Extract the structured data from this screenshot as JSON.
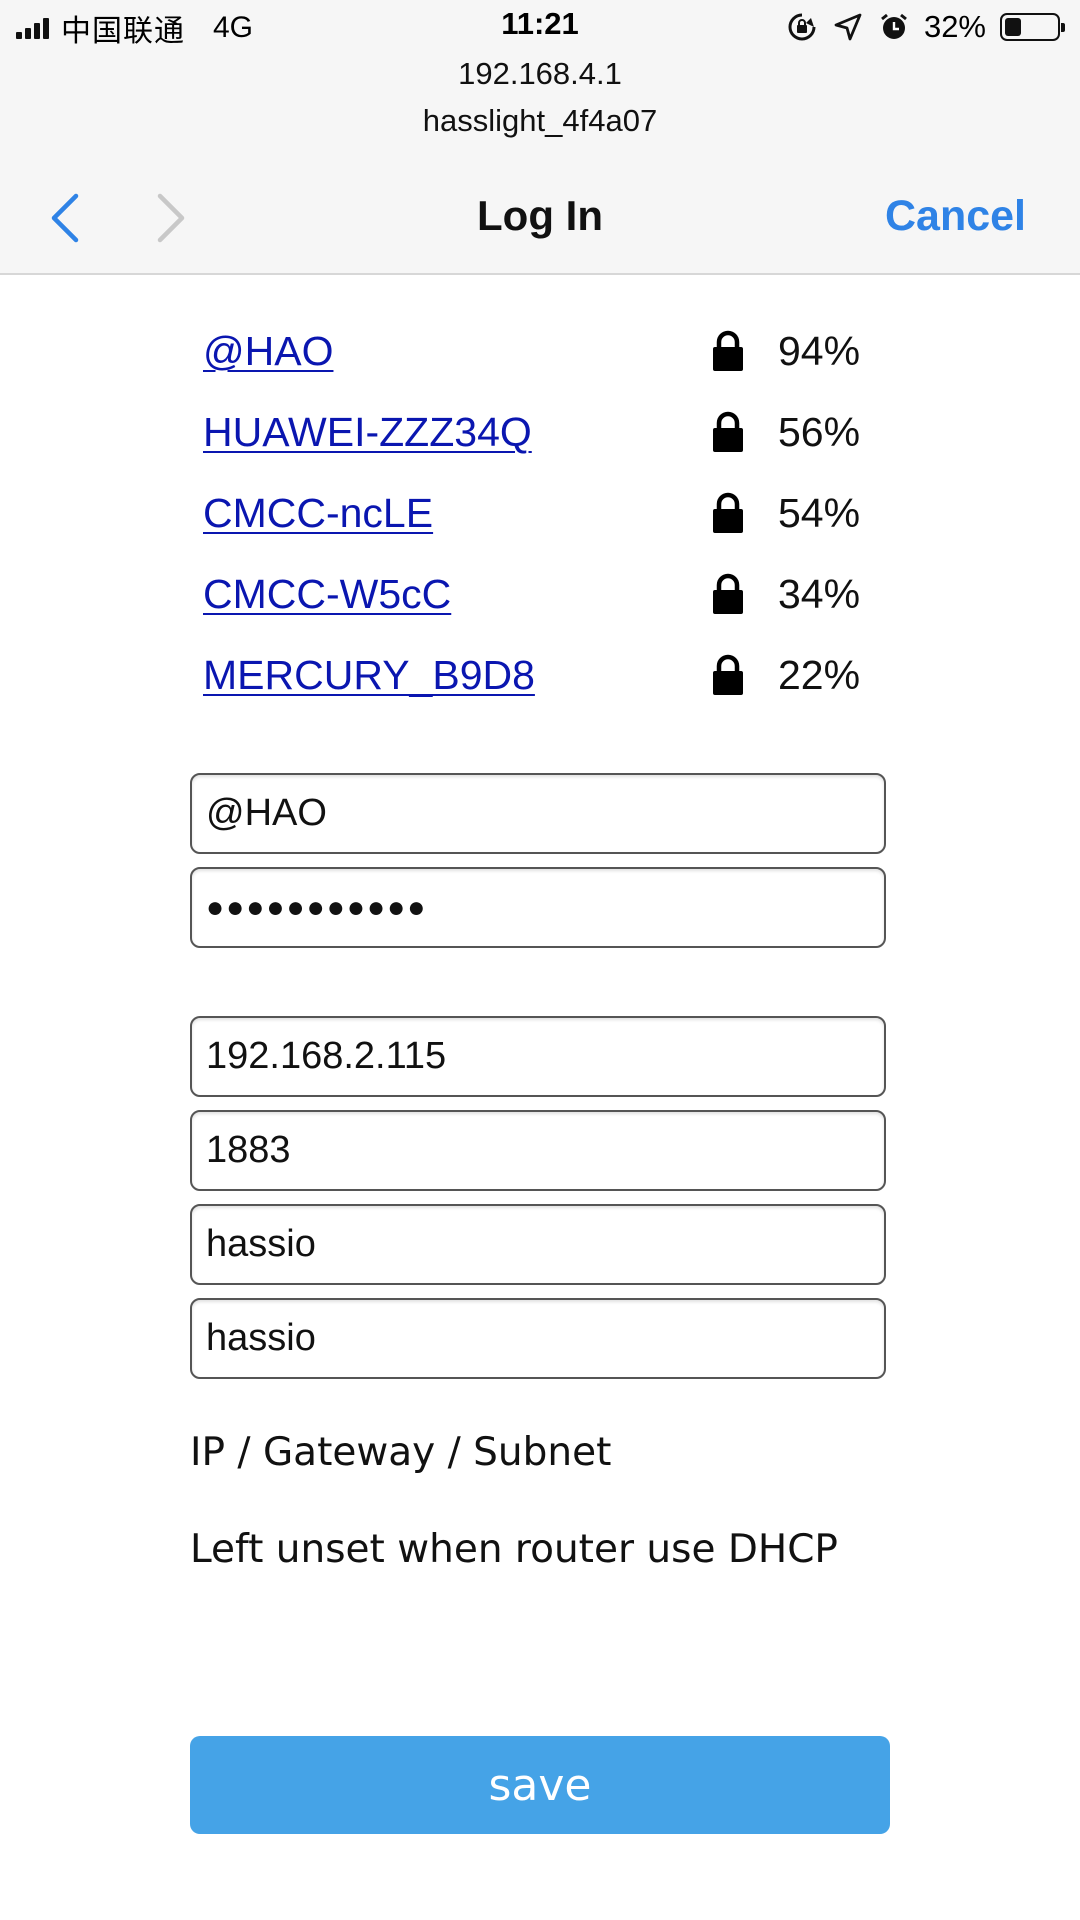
{
  "status_bar": {
    "carrier": "中国联通",
    "network": "4G",
    "time": "11:21",
    "battery": "32%",
    "battery_level": 0.32,
    "icons": [
      "rotation-lock-icon",
      "location-arrow-icon",
      "alarm-icon"
    ]
  },
  "portal": {
    "host": "192.168.4.1",
    "ssid": "hasslight_4f4a07"
  },
  "nav": {
    "title": "Log In",
    "cancel": "Cancel"
  },
  "wifi_networks": [
    {
      "ssid": "@HAO",
      "signal": "94%"
    },
    {
      "ssid": "HUAWEI-ZZZ34Q",
      "signal": "56%"
    },
    {
      "ssid": "CMCC-ncLE",
      "signal": "54%"
    },
    {
      "ssid": "CMCC-W5cC",
      "signal": "34%"
    },
    {
      "ssid": "MERCURY_B9D8",
      "signal": "22%"
    }
  ],
  "form": {
    "ssid_value": "@HAO",
    "password_value": "●●●●●●●●●●●",
    "mqtt_host_value": "192.168.2.115",
    "mqtt_port_value": "1883",
    "mqtt_user_value": "hassio",
    "mqtt_pass_value": "hassio"
  },
  "hints": {
    "ip_line": "IP / Gateway / Subnet",
    "dhcp_line": "Left unset when router use DHCP"
  },
  "save_label": "save",
  "colors": {
    "accent": "#2f83e6",
    "link": "#0a16b0",
    "button": "#45a3e7"
  }
}
